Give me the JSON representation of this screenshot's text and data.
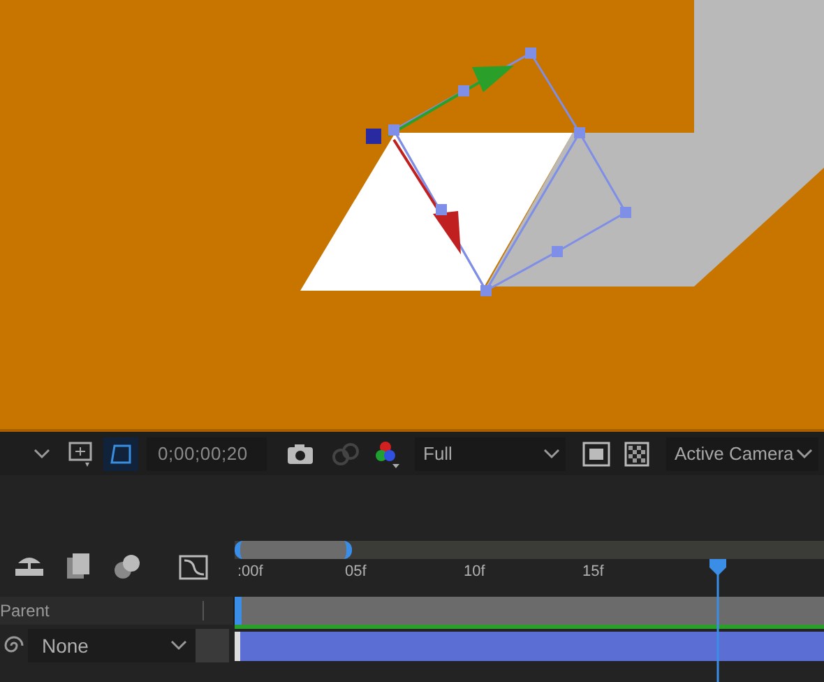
{
  "toolbar": {
    "timecode": "0;00;00;20",
    "mask_path_shown": true,
    "resolution": "Full",
    "view": "Active Camera"
  },
  "timeline": {
    "ruler": [
      ":00f",
      "05f",
      "10f",
      "15f"
    ],
    "columns": [
      "Parent"
    ],
    "layer": {
      "parent": "None"
    },
    "playhead": {
      "level": 0.82
    }
  }
}
